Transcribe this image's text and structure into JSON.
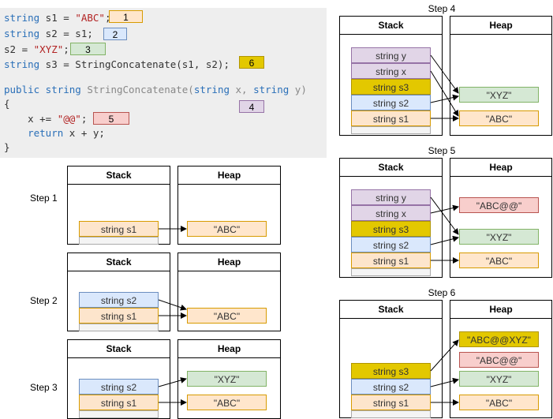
{
  "colors": {
    "stack_s1": "#fde5cc",
    "stack_s1_border": "#d79b00",
    "stack_s2": "#dae8fc",
    "stack_s2_border": "#6c8ebf",
    "stack_s3": "#e3c800",
    "stack_s3_border": "#b09500",
    "stack_xy": "#e1d5e7",
    "stack_xy_border": "#9673a6",
    "heap_abc": "#ffe6cc",
    "heap_abc_border": "#d79b00",
    "heap_xyz": "#d5e8d4",
    "heap_xyz_border": "#82b366",
    "heap_abcat": "#f8cecc",
    "heap_abcat_border": "#b85450",
    "heap_abcatxyz": "#e3c800",
    "heap_abcatxyz_border": "#b09500"
  },
  "code": {
    "line1_type": "string",
    "line1_var": " s1 = ",
    "line1_str": "\"ABC\"",
    "line1_end": ";",
    "line2_type": "string",
    "line2_rest": " s2 = s1;",
    "line3_var": "s2 = ",
    "line3_str": "\"XYZ\"",
    "line3_end": ";",
    "line4_type": "string",
    "line4_rest": " s3 = StringConcatenate(s1, s2);",
    "line6_kw1": "public",
    "line6_kw2": " string",
    "line6_fn": " StringConcatenate(",
    "line6_kw3": "string",
    "line6_x": " x, ",
    "line6_kw4": "string",
    "line6_y": " y)",
    "line7": "{",
    "line8_pre": "    x += ",
    "line8_str": "\"@@\"",
    "line8_end": ";",
    "line9_pre": "    ",
    "line9_kw": "return",
    "line9_rest": " x + y;",
    "line10": "}"
  },
  "badges": {
    "b1": "1",
    "b2": "2",
    "b3": "3",
    "b4": "4",
    "b5": "5",
    "b6": "6"
  },
  "headers": {
    "stack": "Stack",
    "heap": "Heap"
  },
  "labels": {
    "s1": "string s1",
    "s2": "string s2",
    "s3": "string s3",
    "x": "string x",
    "y": "string y",
    "abc": "\"ABC\"",
    "xyz": "\"XYZ\"",
    "abcat": "\"ABC@@\"",
    "abcatxyz": "\"ABC@@XYZ\""
  },
  "steps": {
    "step1": "Step 1",
    "step2": "Step 2",
    "step3": "Step 3",
    "step4": "Step 4",
    "step5": "Step 5",
    "step6": "Step 6"
  }
}
